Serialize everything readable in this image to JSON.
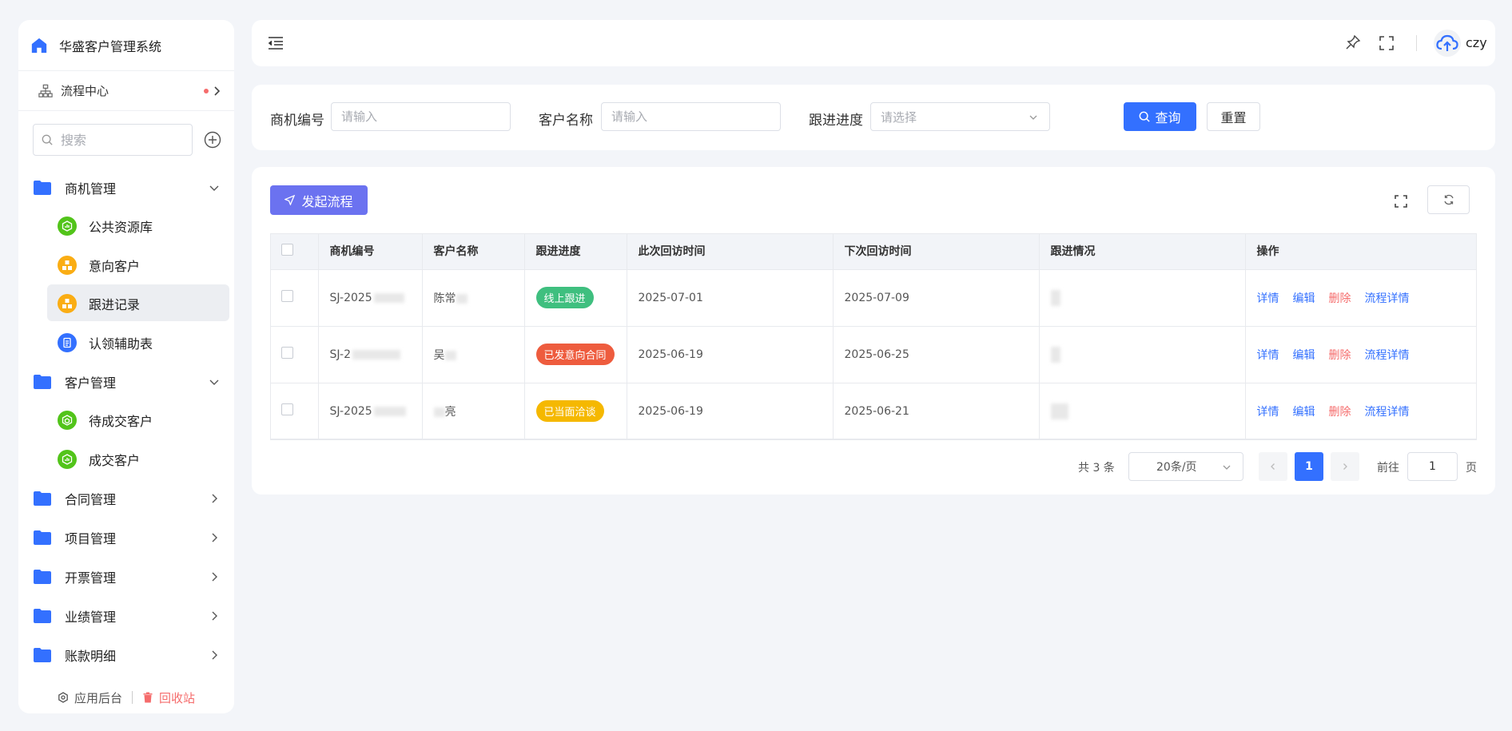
{
  "app": {
    "title": "华盛客户管理系统"
  },
  "sidebar": {
    "flow_center": "流程中心",
    "search_placeholder": "搜索",
    "groups": [
      {
        "label": "商机管理",
        "expanded": true,
        "items": [
          {
            "label": "公共资源库",
            "icon": "chart-badge-icon",
            "color": "#52c41a"
          },
          {
            "label": "意向客户",
            "icon": "cluster-badge-icon",
            "color": "#faad14"
          },
          {
            "label": "跟进记录",
            "icon": "cluster-badge-icon",
            "color": "#faad14",
            "active": true
          },
          {
            "label": "认领辅助表",
            "icon": "document-badge-icon",
            "color": "#3370ff"
          }
        ]
      },
      {
        "label": "客户管理",
        "expanded": true,
        "items": [
          {
            "label": "待成交客户",
            "icon": "cube-badge-icon",
            "color": "#52c41a"
          },
          {
            "label": "成交客户",
            "icon": "chart-badge-icon",
            "color": "#52c41a"
          }
        ]
      },
      {
        "label": "合同管理",
        "expanded": false
      },
      {
        "label": "项目管理",
        "expanded": false
      },
      {
        "label": "开票管理",
        "expanded": false
      },
      {
        "label": "业绩管理",
        "expanded": false
      },
      {
        "label": "账款明细",
        "expanded": false
      }
    ],
    "footer": {
      "admin": "应用后台",
      "trash": "回收站"
    }
  },
  "topbar": {
    "username": "czy"
  },
  "filter": {
    "fields": [
      {
        "label": "商机编号",
        "placeholder": "请输入"
      },
      {
        "label": "客户名称",
        "placeholder": "请输入"
      },
      {
        "label": "跟进进度",
        "placeholder": "请选择"
      }
    ],
    "query_label": "查询",
    "reset_label": "重置"
  },
  "table": {
    "start_flow_label": "发起流程",
    "columns": [
      "商机编号",
      "客户名称",
      "跟进进度",
      "此次回访时间",
      "下次回访时间",
      "跟进情况",
      "操作"
    ],
    "rows": [
      {
        "code": "SJ-2025",
        "name": "陈常",
        "progress": "线上跟进",
        "progress_color": "#3fbf7f",
        "this_visit": "2025-07-01",
        "next_visit": "2025-07-09"
      },
      {
        "code": "SJ-2",
        "name": "吴",
        "progress": "已发意向合同",
        "progress_color": "#ee5c3e",
        "this_visit": "2025-06-19",
        "next_visit": "2025-06-25"
      },
      {
        "code": "SJ-2025",
        "name": "亮",
        "progress": "已当面洽谈",
        "progress_color": "#f5b800",
        "this_visit": "2025-06-19",
        "next_visit": "2025-06-21"
      }
    ],
    "actions": [
      "详情",
      "编辑",
      "删除",
      "流程详情"
    ]
  },
  "pagination": {
    "total": "共 3 条",
    "page_size": "20条/页",
    "current": "1",
    "goto_label": "前往",
    "goto_value": "1",
    "unit": "页"
  }
}
